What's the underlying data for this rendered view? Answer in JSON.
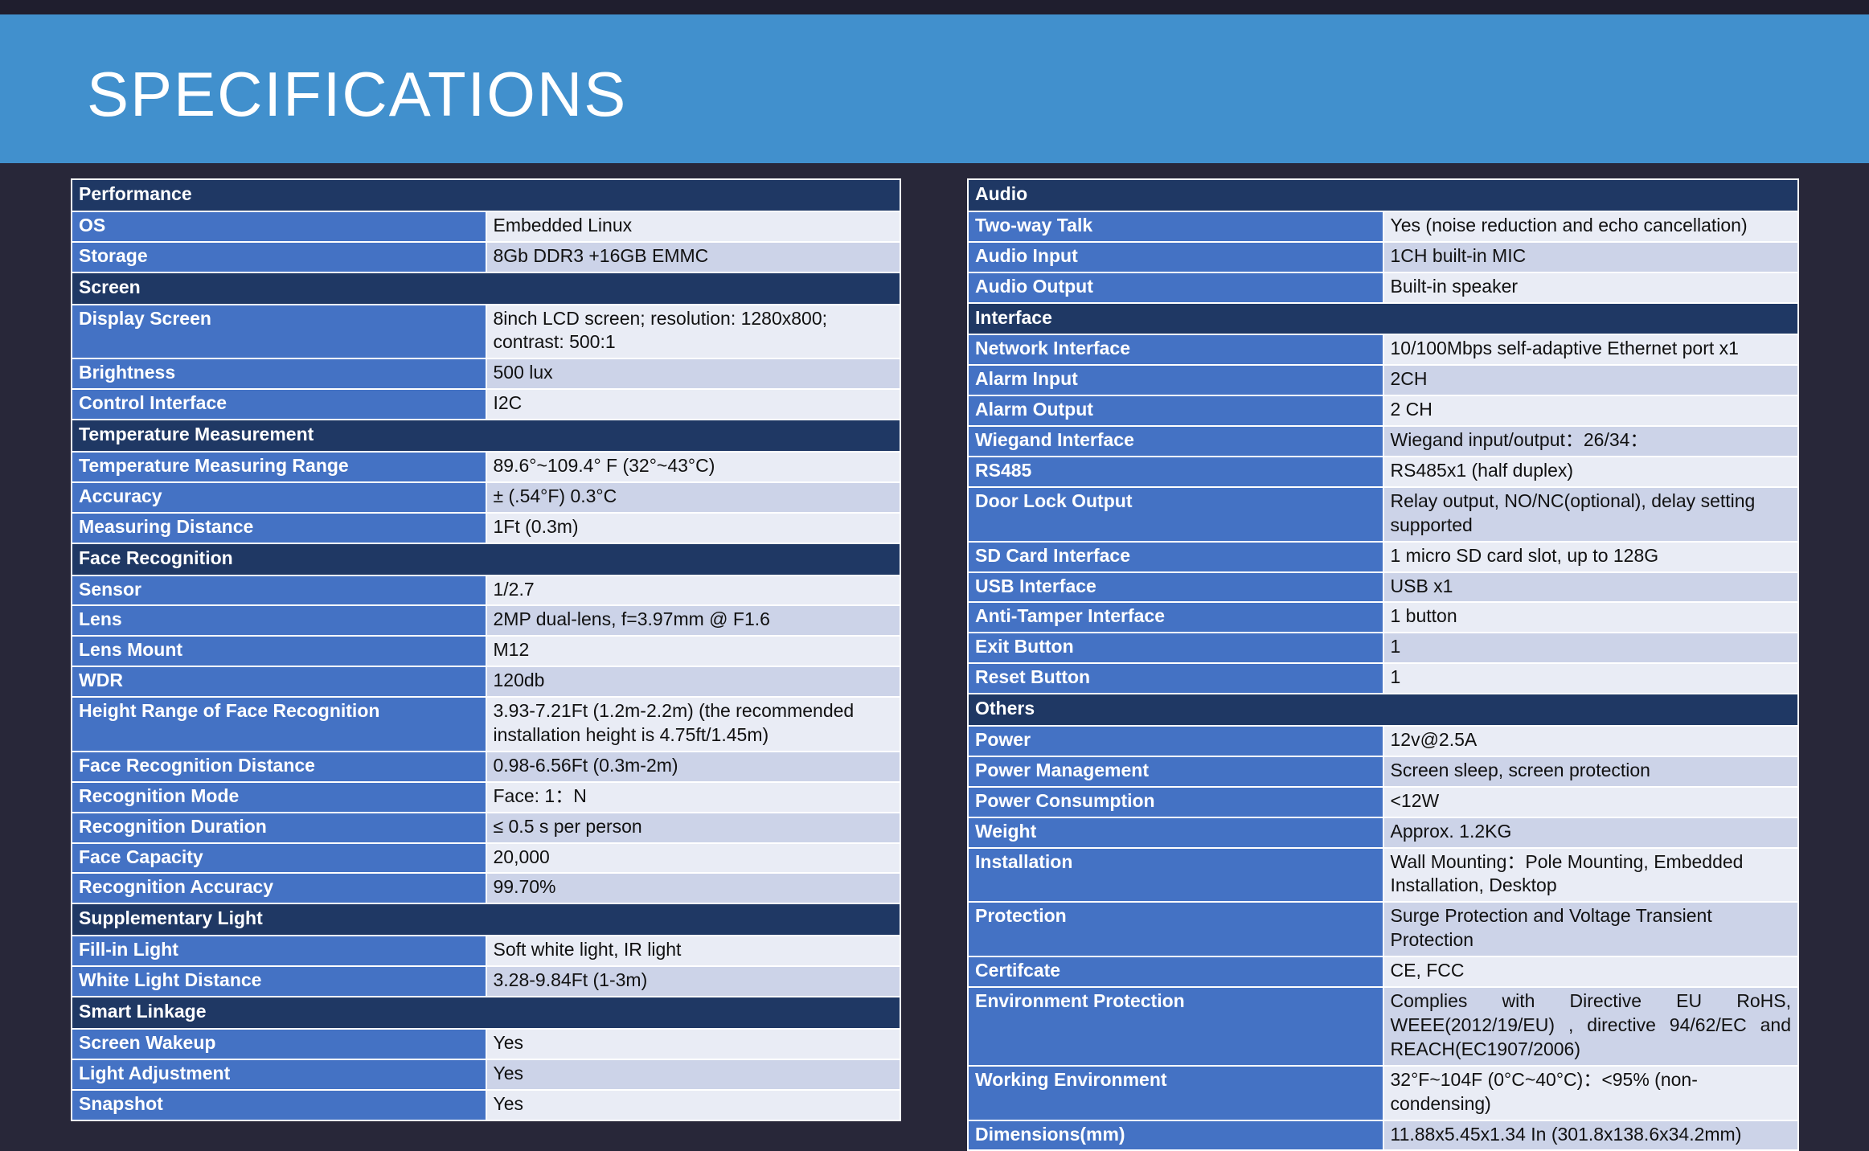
{
  "banner": {
    "title": "SPECIFICATIONS"
  },
  "left_column": [
    {
      "section": "Performance",
      "rows": [
        {
          "label": "OS",
          "value": "Embedded Linux"
        },
        {
          "label": "Storage",
          "value": "8Gb DDR3 +16GB EMMC"
        }
      ]
    },
    {
      "section": "Screen",
      "rows": [
        {
          "label": "Display Screen",
          "value": "8inch LCD screen; resolution: 1280x800; contrast: 500:1"
        },
        {
          "label": "Brightness",
          "value": "500 lux"
        },
        {
          "label": "Control Interface",
          "value": "I2C"
        }
      ]
    },
    {
      "section": "Temperature Measurement",
      "rows": [
        {
          "label": "Temperature Measuring Range",
          "value": "89.6°~109.4° F (32°~43°C)"
        },
        {
          "label": "Accuracy",
          "value": "± (.54°F) 0.3°C"
        },
        {
          "label": "Measuring Distance",
          "value": "1Ft (0.3m)"
        }
      ]
    },
    {
      "section": "Face Recognition",
      "rows": [
        {
          "label": "Sensor",
          "value": "1/2.7"
        },
        {
          "label": "Lens",
          "value": "2MP dual-lens, f=3.97mm @ F1.6"
        },
        {
          "label": "Lens Mount",
          "value": "M12"
        },
        {
          "label": "WDR",
          "value": "120db"
        },
        {
          "label": "Height Range of Face Recognition",
          "value": "3.93-7.21Ft (1.2m-2.2m) (the recommended installation height is 4.75ft/1.45m)"
        },
        {
          "label": "Face Recognition Distance",
          "value": "0.98-6.56Ft (0.3m-2m)"
        },
        {
          "label": "Recognition Mode",
          "value": "Face: 1：N"
        },
        {
          "label": "Recognition Duration",
          "value": "≤ 0.5 s per person"
        },
        {
          "label": "Face Capacity",
          "value": "20,000"
        },
        {
          "label": "Recognition Accuracy",
          "value": "99.70%"
        }
      ]
    },
    {
      "section": "Supplementary Light",
      "rows": [
        {
          "label": "Fill-in Light",
          "value": "Soft white light, IR light"
        },
        {
          "label": "White Light Distance",
          "value": "3.28-9.84Ft (1-3m)"
        }
      ]
    },
    {
      "section": "Smart Linkage",
      "rows": [
        {
          "label": "Screen Wakeup",
          "value": "Yes"
        },
        {
          "label": "Light Adjustment",
          "value": "Yes"
        },
        {
          "label": "Snapshot",
          "value": "Yes"
        }
      ]
    }
  ],
  "right_column": [
    {
      "section": "Audio",
      "rows": [
        {
          "label": "Two-way Talk",
          "value": "Yes (noise reduction and echo cancellation)"
        },
        {
          "label": "Audio Input",
          "value": "1CH built-in MIC"
        },
        {
          "label": "Audio Output",
          "value": "Built-in speaker"
        }
      ]
    },
    {
      "section": "Interface",
      "rows": [
        {
          "label": "Network Interface",
          "value": "10/100Mbps self-adaptive Ethernet port x1"
        },
        {
          "label": "Alarm Input",
          "value": "2CH"
        },
        {
          "label": "Alarm Output",
          "value": "2 CH"
        },
        {
          "label": "Wiegand Interface",
          "value": "Wiegand input/output：26/34："
        },
        {
          "label": "RS485",
          "value": "RS485x1 (half duplex)"
        },
        {
          "label": "Door Lock Output",
          "value": "Relay output, NO/NC(optional), delay setting supported"
        },
        {
          "label": "SD Card Interface",
          "value": "1 micro SD card slot, up to 128G"
        },
        {
          "label": "USB Interface",
          "value": "USB x1"
        },
        {
          "label": "Anti-Tamper Interface",
          "value": "1 button"
        },
        {
          "label": "Exit Button",
          "value": "1"
        },
        {
          "label": "Reset Button",
          "value": "1"
        }
      ]
    },
    {
      "section": "Others",
      "rows": [
        {
          "label": "Power",
          "value": "12v@2.5A"
        },
        {
          "label": "Power Management",
          "value": "Screen sleep, screen protection"
        },
        {
          "label": "Power Consumption",
          "value": "<12W"
        },
        {
          "label": "Weight",
          "value": "Approx. 1.2KG"
        },
        {
          "label": "Installation",
          "value": "Wall Mounting：Pole Mounting, Embedded Installation, Desktop"
        },
        {
          "label": "Protection",
          "value": "Surge Protection and Voltage Transient Protection"
        },
        {
          "label": "Certifcate",
          "value": "CE, FCC"
        },
        {
          "label": "Environment Protection",
          "value": "Complies with Directive EU RoHS, WEEE(2012/19/EU) , directive 94/62/EC and REACH(EC1907/2006)",
          "justify": true
        },
        {
          "label": "Working Environment",
          "value": "32°F~104F (0°C~40°C)：<95% (non-condensing)",
          "lines": [
            "32°F~104F (0°C~40°C)：",
            "<95% (non-condensing)"
          ]
        },
        {
          "label": "Dimensions(mm)",
          "value": "11.88x5.45x1.34 In (301.8x138.6x34.2mm)"
        }
      ]
    }
  ],
  "colors": {
    "banner_blue": "#4190cd",
    "background_dark": "#282739",
    "section_header": "#1f3864",
    "label_blue": "#4472c4",
    "value_light": "#e9ecf5",
    "value_alt": "#ccd3e8"
  }
}
